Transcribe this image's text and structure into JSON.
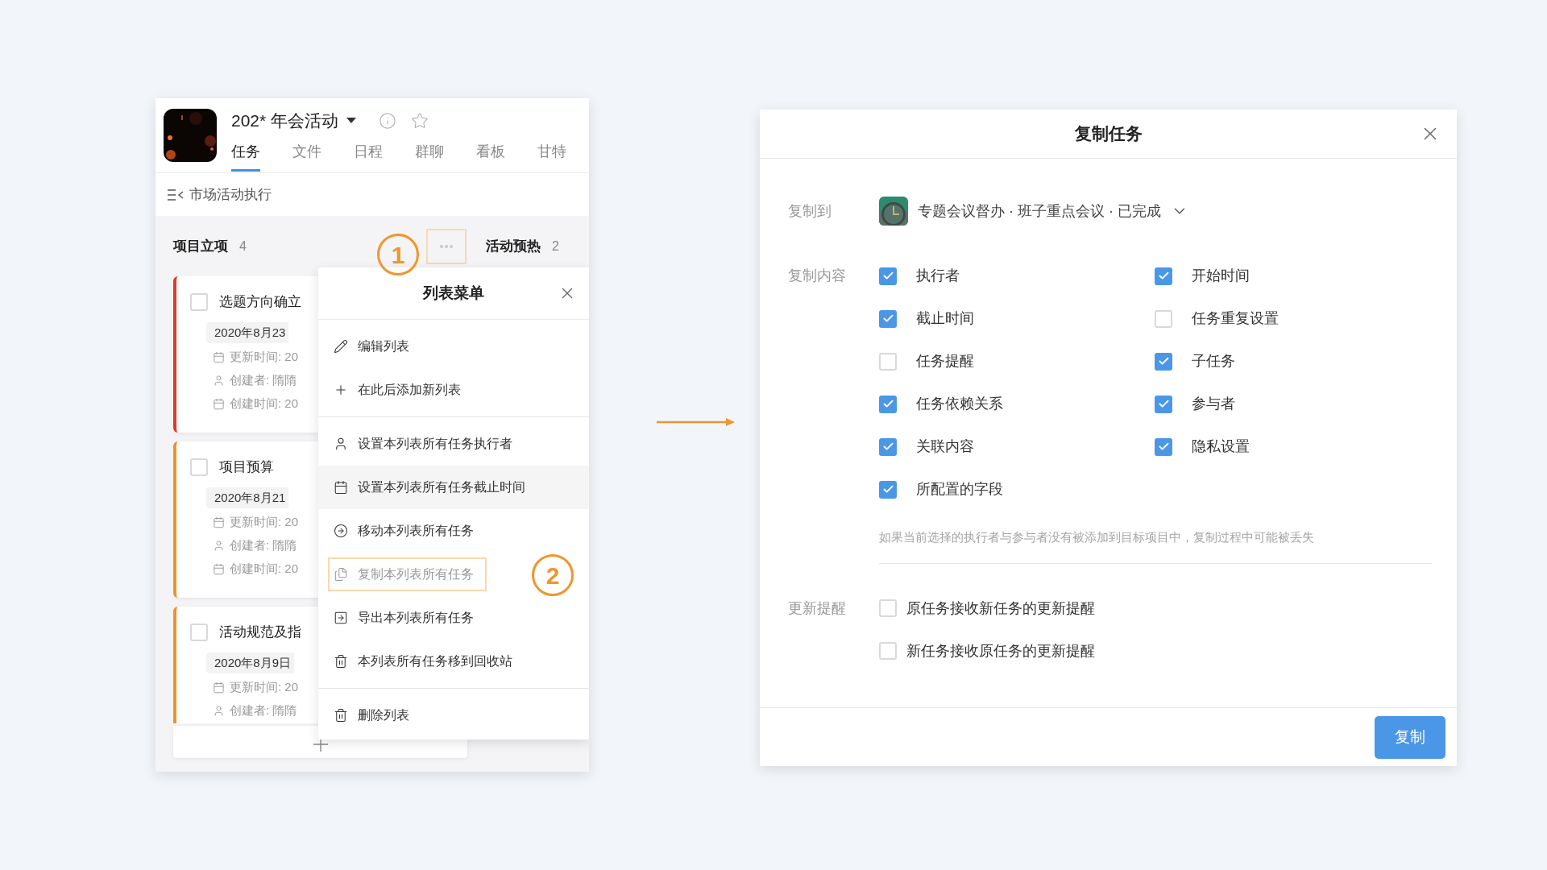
{
  "project": {
    "title": "202* 年会活动",
    "tabs": [
      {
        "label": "任务",
        "selected": true
      },
      {
        "label": "文件",
        "selected": false
      },
      {
        "label": "日程",
        "selected": false
      },
      {
        "label": "群聊",
        "selected": false
      },
      {
        "label": "看板",
        "selected": false
      },
      {
        "label": "甘特",
        "selected": false
      }
    ]
  },
  "breadcrumb": "市场活动执行",
  "columns": [
    {
      "title": "项目立项",
      "count": "4"
    },
    {
      "title": "活动预热",
      "count": "2"
    }
  ],
  "cards": [
    {
      "title": "选题方向确立",
      "checked": false,
      "color": "#e0392b",
      "date": "2020年8月23",
      "meta": [
        {
          "kind": "calendar",
          "text": "更新时间: 20"
        },
        {
          "kind": "person",
          "text": "创建者: 隋隋"
        },
        {
          "kind": "calendar",
          "text": "创建时间: 20"
        }
      ]
    },
    {
      "title": "项目预算",
      "checked": false,
      "color": "#f0902e",
      "date": "2020年8月21",
      "meta": [
        {
          "kind": "calendar",
          "text": "更新时间: 20"
        },
        {
          "kind": "person",
          "text": "创建者: 隋隋"
        },
        {
          "kind": "calendar",
          "text": "创建时间: 20"
        }
      ]
    },
    {
      "title": "活动规范及指",
      "checked": false,
      "color": "#f0902e",
      "date": "2020年8月9日",
      "meta": [
        {
          "kind": "calendar",
          "text": "更新时间: 20"
        },
        {
          "kind": "person",
          "text": "创建者: 隋隋"
        }
      ]
    }
  ],
  "list_menu": {
    "title": "列表菜单",
    "sections": [
      [
        {
          "kind": "edit",
          "label": "编辑列表",
          "hovered": false,
          "highlighted": false
        },
        {
          "kind": "add",
          "label": "在此后添加新列表",
          "hovered": false,
          "highlighted": false
        }
      ],
      [
        {
          "kind": "person",
          "label": "设置本列表所有任务执行者",
          "hovered": false,
          "highlighted": false
        },
        {
          "kind": "calendar",
          "label": "设置本列表所有任务截止时间",
          "hovered": true,
          "highlighted": false
        },
        {
          "kind": "move",
          "label": "移动本列表所有任务",
          "hovered": false,
          "highlighted": false
        },
        {
          "kind": "copy",
          "label": "复制本列表所有任务",
          "hovered": false,
          "highlighted": true
        },
        {
          "kind": "export",
          "label": "导出本列表所有任务",
          "hovered": false,
          "highlighted": false
        },
        {
          "kind": "trash",
          "label": "本列表所有任务移到回收站",
          "hovered": false,
          "highlighted": false
        }
      ],
      [
        {
          "kind": "trash",
          "label": "删除列表",
          "hovered": false,
          "highlighted": false
        }
      ]
    ]
  },
  "annotations": [
    {
      "label": "1"
    },
    {
      "label": "2"
    }
  ],
  "dialog": {
    "title": "复制任务",
    "target_label": "复制到",
    "target": "专题会议督办 · 班子重点会议 · 已完成",
    "content_label": "复制内容",
    "options": [
      {
        "label": "执行者",
        "checked": true
      },
      {
        "label": "开始时间",
        "checked": true
      },
      {
        "label": "截止时间",
        "checked": true
      },
      {
        "label": "任务重复设置",
        "checked": false
      },
      {
        "label": "任务提醒",
        "checked": false
      },
      {
        "label": "子任务",
        "checked": true
      },
      {
        "label": "任务依赖关系",
        "checked": true
      },
      {
        "label": "参与者",
        "checked": true
      },
      {
        "label": "关联内容",
        "checked": true
      },
      {
        "label": "隐私设置",
        "checked": true
      },
      {
        "label": "所配置的字段",
        "checked": true
      }
    ],
    "hint": "如果当前选择的执行者与参与者没有被添加到目标项目中，复制过程中可能被丢失",
    "notify_label": "更新提醒",
    "notify_options": [
      {
        "label": "原任务接收新任务的更新提醒",
        "checked": false
      },
      {
        "label": "新任务接收原任务的更新提醒",
        "checked": false
      }
    ],
    "button": "复制"
  }
}
